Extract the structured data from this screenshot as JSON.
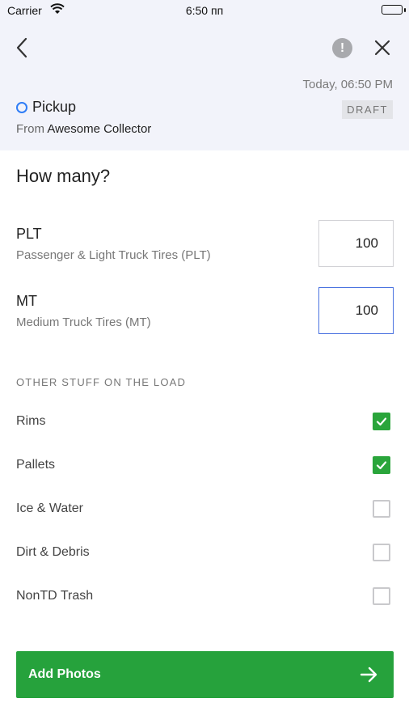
{
  "status_bar": {
    "carrier": "Carrier",
    "time": "6:50 пп"
  },
  "header": {
    "timestamp": "Today, 06:50 PM",
    "type_label": "Pickup",
    "status_badge": "DRAFT",
    "from_prefix": "From",
    "collector_name": "Awesome Collector",
    "accent_color": "#2f7df6",
    "background_color": "#f2f3fa"
  },
  "form": {
    "heading": "How many?",
    "quantities": [
      {
        "code": "PLT",
        "description": "Passenger & Light Truck Tires (PLT)",
        "value": "100"
      },
      {
        "code": "MT",
        "description": "Medium Truck Tires (MT)",
        "value": "100"
      }
    ],
    "other_section_label": "OTHER STUFF ON THE LOAD",
    "other_items": [
      {
        "label": "Rims",
        "checked": true
      },
      {
        "label": "Pallets",
        "checked": true
      },
      {
        "label": "Ice & Water",
        "checked": false
      },
      {
        "label": "Dirt & Debris",
        "checked": false
      },
      {
        "label": "NonTD Trash",
        "checked": false
      }
    ]
  },
  "footer": {
    "primary_button": "Add Photos",
    "button_color": "#26a23c"
  },
  "icons": {
    "back": "chevron-left-icon",
    "alert": "exclamation-circle-icon",
    "close": "close-icon",
    "arrow": "arrow-right-icon",
    "check": "check-icon"
  }
}
